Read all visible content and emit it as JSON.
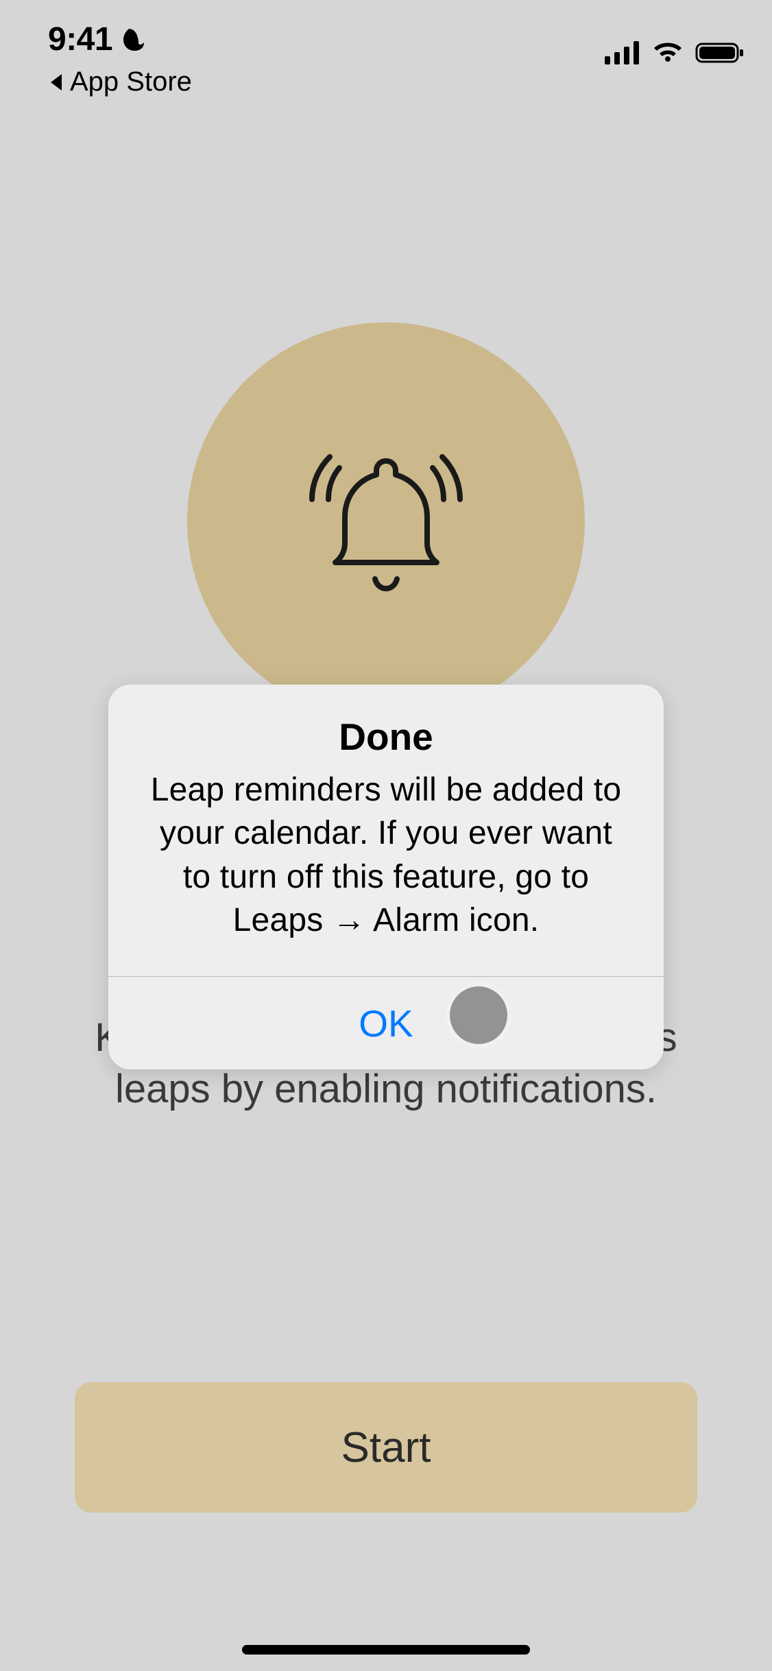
{
  "status_bar": {
    "time": "9:41",
    "back_label": "App Store"
  },
  "screen": {
    "message": "Keep informed about your baby's leaps by enabling notifications.",
    "start_label": "Start"
  },
  "alert": {
    "title": "Done",
    "message": "Leap reminders will be added to your calendar. If you ever want to turn off this feature, go to Leaps → Alarm icon.",
    "ok_label": "OK"
  }
}
